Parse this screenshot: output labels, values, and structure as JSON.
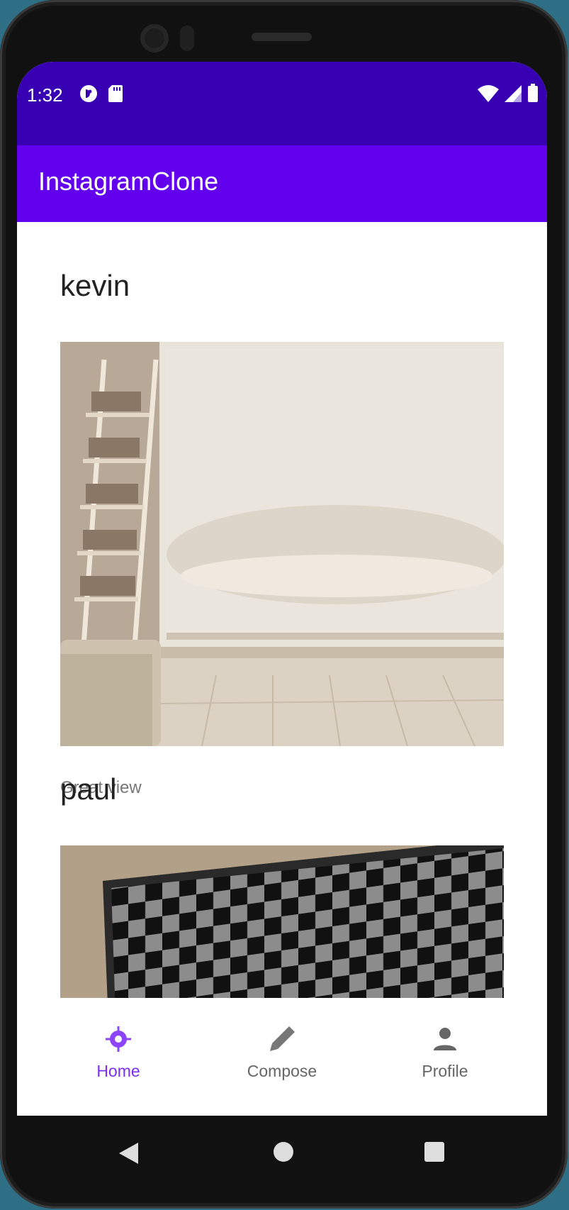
{
  "status_bar": {
    "time": "1:32",
    "left_icons": [
      "circle-icon",
      "sd-card-icon"
    ],
    "right_icons": [
      "wifi-icon",
      "signal-icon",
      "battery-icon"
    ]
  },
  "app_bar": {
    "title": "InstagramClone"
  },
  "feed": {
    "posts": [
      {
        "user": "kevin",
        "caption": "Great view",
        "image": "room-window-photo"
      },
      {
        "user": "paul",
        "caption": "",
        "image": "checkerboard-photo"
      }
    ]
  },
  "bottom_nav": {
    "items": [
      {
        "label": "Home",
        "icon": "home-crosshair-icon",
        "active": true
      },
      {
        "label": "Compose",
        "icon": "pencil-icon",
        "active": false
      },
      {
        "label": "Profile",
        "icon": "person-icon",
        "active": false
      }
    ]
  },
  "colors": {
    "status_bar": "#3700b3",
    "app_bar": "#6200ee",
    "nav_active": "#8b44f7",
    "nav_inactive": "#666666"
  }
}
